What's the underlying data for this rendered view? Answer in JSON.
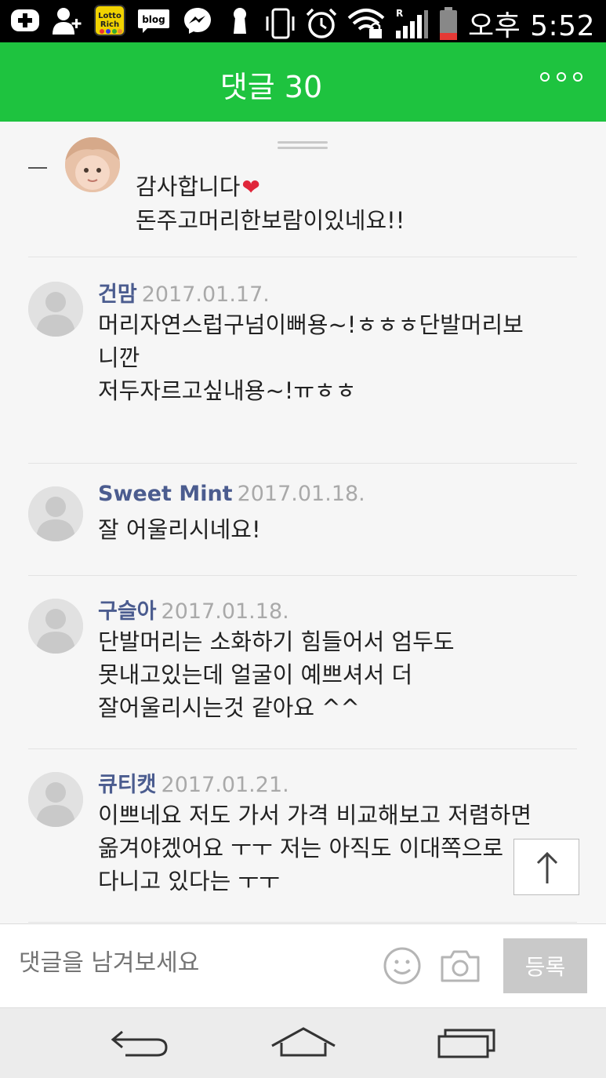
{
  "status_bar": {
    "time": "오후 5:52",
    "lotto_label_1": "Lotto",
    "lotto_label_2": "Rich",
    "blog_label": "blog",
    "roaming_label": "R"
  },
  "header": {
    "title": "댓글 30"
  },
  "comments": [
    {
      "author": "",
      "date": "",
      "lines": [
        "감사합니다",
        "돈주고머리한보람이있네요!!"
      ],
      "heart": "❤"
    },
    {
      "author": "건맘",
      "date": "2017.01.17.",
      "lines": [
        "머리자연스럽구넘이뻐용~!ㅎㅎㅎ단발머리보",
        "니깐",
        "저두자르고싶내용~!ㅠㅎㅎ"
      ]
    },
    {
      "author": "Sweet Mint",
      "date": "2017.01.18.",
      "lines": [
        "잘 어울리시네요!"
      ]
    },
    {
      "author": "구슬아",
      "date": "2017.01.18.",
      "lines": [
        "단발머리는 소화하기 힘들어서 엄두도",
        "못내고있는데 얼굴이 예쁘셔서 더",
        "잘어울리시는것 같아요 ^^"
      ]
    },
    {
      "author": "큐티캣",
      "date": "2017.01.21.",
      "lines": [
        "이쁘네요 저도 가서 가격 비교해보고 저렴하면",
        "옮겨야겠어요 ㅜㅜ 저는 아직도 이대쪽으로",
        "다니고 있다는 ㅜㅜ"
      ]
    }
  ],
  "input_bar": {
    "placeholder": "댓글을 남겨보세요",
    "submit_label": "등록"
  },
  "colors": {
    "header": "#1ec33f",
    "author": "#4b5c8f",
    "date": "#a9a9a9"
  }
}
